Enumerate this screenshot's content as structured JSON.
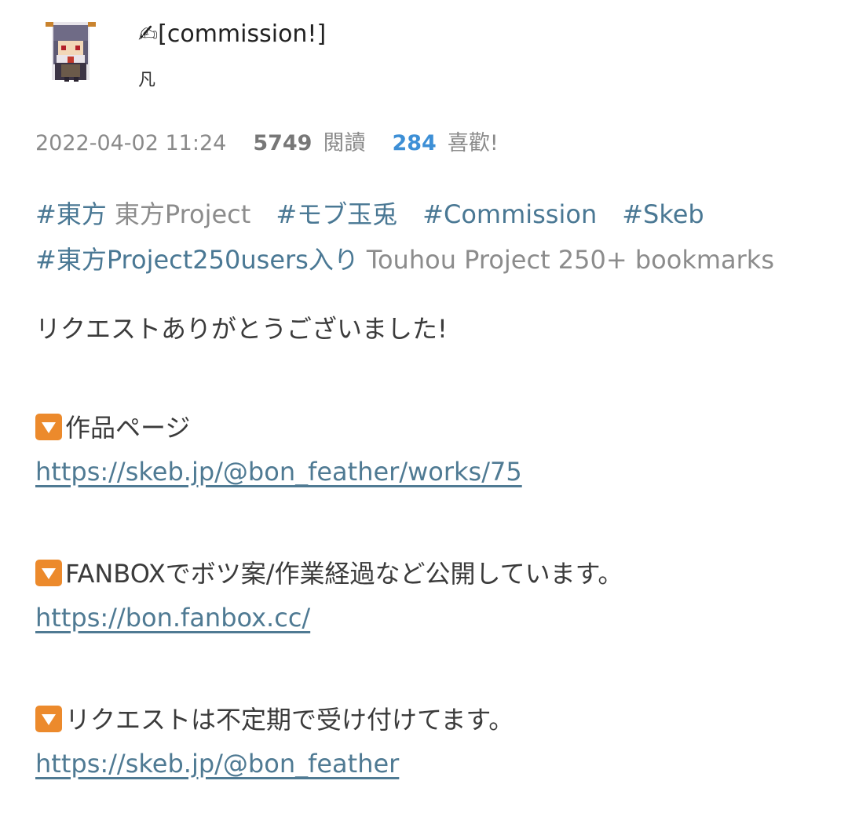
{
  "post": {
    "title": "✍[commission!]",
    "author": "凡",
    "date": "2022-04-02 11:24",
    "views": "5749",
    "views_label": "閱讀",
    "likes": "284",
    "likes_label": "喜歡!"
  },
  "tags": [
    {
      "tag": "#東方",
      "translation": "東方Project"
    },
    {
      "tag": "#モブ玉兎",
      "translation": ""
    },
    {
      "tag": "#Commission",
      "translation": ""
    },
    {
      "tag": "#Skeb",
      "translation": ""
    },
    {
      "tag": "#東方Project250users入り",
      "translation": "Touhou Project 250+ bookmarks"
    }
  ],
  "body": {
    "thanks": "リクエストありがとうございました!",
    "section1_label": "作品ページ",
    "section1_link": "https://skeb.jp/@bon_feather/works/75",
    "section2_label": "FANBOXでボツ案/作業経過など公開しています。",
    "section2_link": "https://bon.fanbox.cc/",
    "section3_label": "リクエストは不定期で受け付けてます。",
    "section3_link": "https://skeb.jp/@bon_feather"
  },
  "icons": {
    "avatar": "pixel-art-character-avatar",
    "bullet": "down-triangle-button-icon"
  },
  "colors": {
    "tag": "#4a7894",
    "link": "#4f7a93",
    "likes": "#3d8fd6",
    "bullet": "#ec8a2c"
  }
}
